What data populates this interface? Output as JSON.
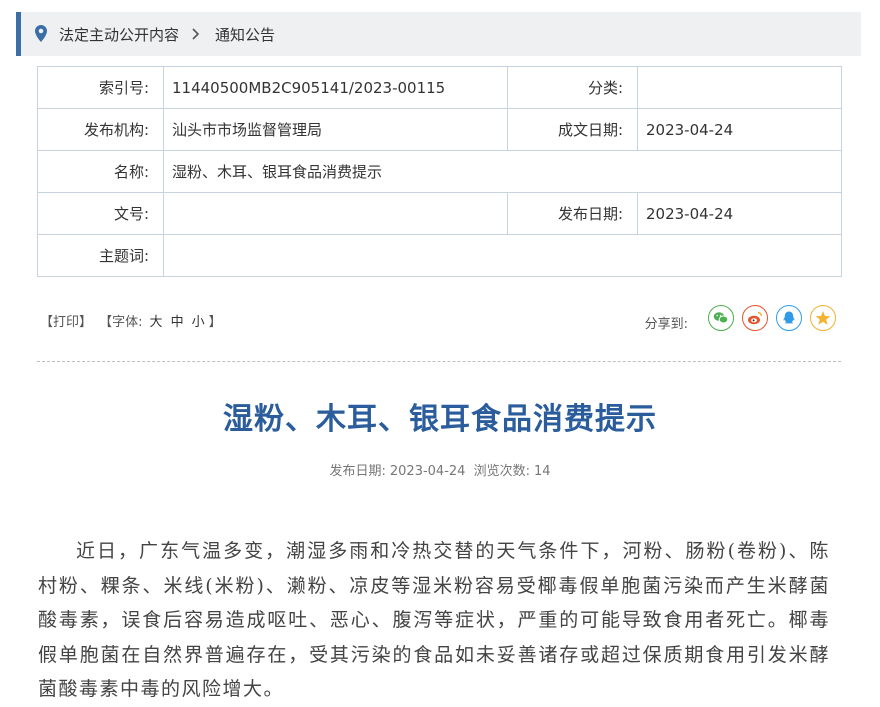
{
  "breadcrumb": {
    "items": [
      "法定主动公开内容",
      "通知公告"
    ],
    "icon": "location-pin-icon"
  },
  "meta": {
    "index_label": "索引号:",
    "index_value": "11440500MB2C905141/2023-00115",
    "category_label": "分类:",
    "category_value": "",
    "publisher_label": "发布机构:",
    "publisher_value": "汕头市市场监督管理局",
    "created_label": "成文日期:",
    "created_value": "2023-04-24",
    "name_label": "名称:",
    "name_value": "湿粉、木耳、银耳食品消费提示",
    "docno_label": "文号:",
    "docno_value": "",
    "pubdate_label": "发布日期:",
    "pubdate_value": "2023-04-24",
    "keywords_label": "主题词:",
    "keywords_value": ""
  },
  "toolbar": {
    "print": "【打印】",
    "font_open": "【字体:",
    "font_large": "大",
    "font_medium": "中",
    "font_small": "小",
    "font_close": "】",
    "share_label": "分享到:"
  },
  "share_icons": [
    {
      "name": "wechat-icon",
      "color": "#4caf50"
    },
    {
      "name": "weibo-icon",
      "color": "#e8542c"
    },
    {
      "name": "qq-icon",
      "color": "#2f9be8"
    },
    {
      "name": "qzone-icon",
      "color": "#f2b32f"
    }
  ],
  "article": {
    "title": "湿粉、木耳、银耳食品消费提示",
    "pubdate_label": "发布日期:",
    "pubdate": "2023-04-24",
    "views_label": "浏览次数:",
    "views": "14",
    "paragraph": "近日，广东气温多变，潮湿多雨和冷热交替的天气条件下，河粉、肠粉(卷粉)、陈村粉、粿条、米线(米粉)、濑粉、凉皮等湿米粉容易受椰毒假单胞菌污染而产生米酵菌酸毒素，误食后容易造成呕吐、恶心、腹泻等症状，严重的可能导致食用者死亡。椰毒假单胞菌在自然界普遍存在，受其污染的食品如未妥善诸存或超过保质期食用引发米酵菌酸毒素中毒的风险增大。"
  },
  "colors": {
    "accent": "#3a6ea5",
    "title": "#2b5d9c",
    "table_border": "#c8d3e0"
  }
}
